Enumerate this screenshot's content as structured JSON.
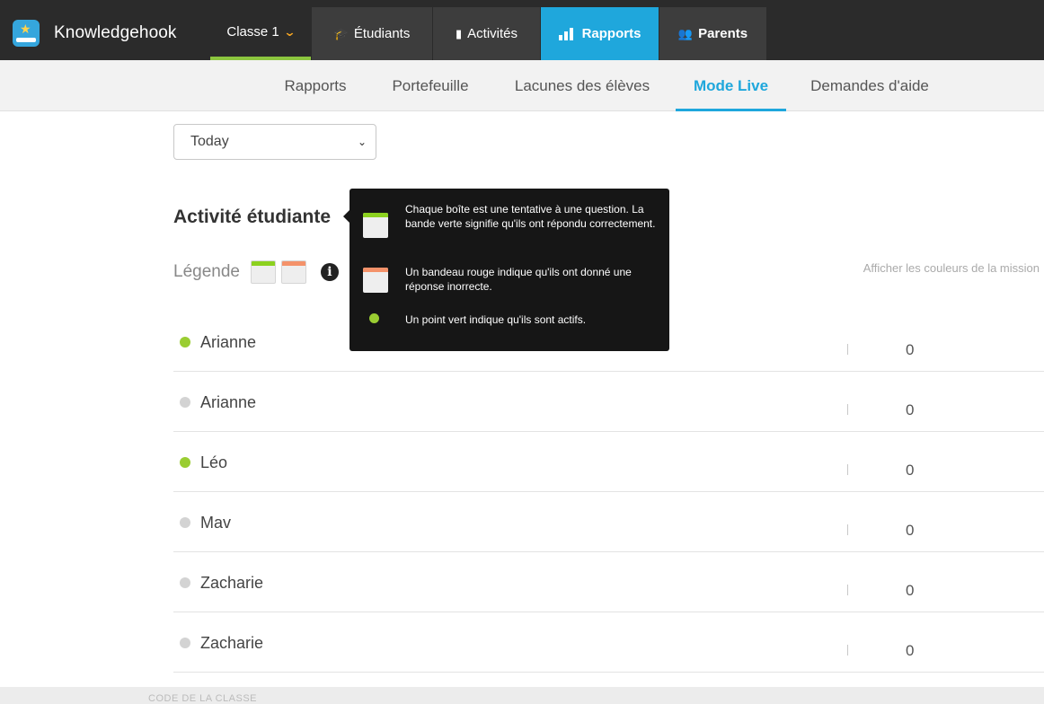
{
  "brand": {
    "name": "Knowledgehook"
  },
  "topnav": {
    "classe": "Classe 1",
    "etudiants": "Étudiants",
    "activites": "Activités",
    "rapports": "Rapports",
    "parents": "Parents"
  },
  "subnav": {
    "items": [
      "Rapports",
      "Portefeuille",
      "Lacunes des élèves",
      "Mode Live",
      "Demandes d'aide"
    ],
    "active": "Mode Live"
  },
  "date_select": {
    "value": "Today"
  },
  "section": {
    "title": "Activité étudiante",
    "legend_label": "Légende",
    "mission_colors_link": "Afficher les couleurs de la mission"
  },
  "tooltip": {
    "line1": "Chaque boîte est une tentative à une question. La bande verte signifie qu'ils ont répondu correctement.",
    "line2": "Un bandeau rouge indique qu'ils ont donné une réponse inorrecte.",
    "line3": "Un point vert indique qu'ils sont actifs."
  },
  "colors": {
    "correct_strip": "#8cd11f",
    "incorrect_strip": "#f4926a",
    "active_dot": "#9acd32",
    "inactive_dot": "#d3d3d3",
    "accent": "#1fa7dc"
  },
  "students": [
    {
      "name": "Arianne",
      "active": true,
      "count": "0"
    },
    {
      "name": "Arianne",
      "active": false,
      "count": "0"
    },
    {
      "name": "Léo",
      "active": true,
      "count": "0"
    },
    {
      "name": "Mav",
      "active": false,
      "count": "0"
    },
    {
      "name": "Zacharie",
      "active": false,
      "count": "0"
    },
    {
      "name": "Zacharie",
      "active": false,
      "count": "0"
    }
  ],
  "footer": {
    "text": "CODE DE LA CLASSE"
  }
}
